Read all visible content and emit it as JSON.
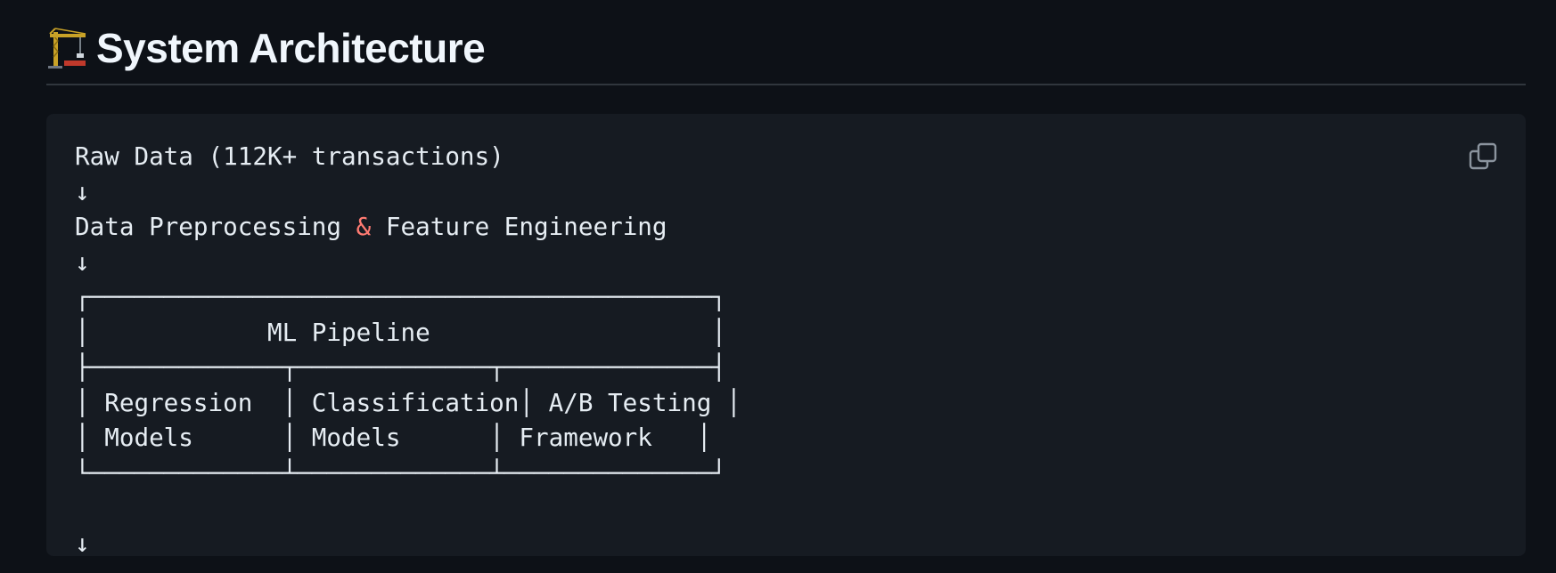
{
  "heading": {
    "icon": "construction-crane-icon",
    "title": "System Architecture"
  },
  "code": {
    "line1": "Raw Data (112K+ transactions)",
    "arrow": "↓",
    "line3_before": "Data Preprocessing ",
    "line3_amp": "&",
    "line3_after": " Feature Engineering",
    "box_top": "┌──────────────────────────────────────────┐",
    "box_title_row": "│            ML Pipeline                   │",
    "box_divider": "├─────────────┬─────────────┬──────────────┤",
    "box_row1": "│ Regression  │ Classification│ A/B Testing │",
    "box_row2": "│ Models      │ Models      │ Framework   │",
    "box_bottom": "└─────────────┴─────────────┴──────────────┘"
  },
  "copy_button": {
    "icon": "copy-icon"
  },
  "colors": {
    "background": "#0d1117",
    "code_background": "#161b22",
    "text": "#e6edf3",
    "ampersand": "#ff7b72",
    "rule": "#30363d"
  }
}
